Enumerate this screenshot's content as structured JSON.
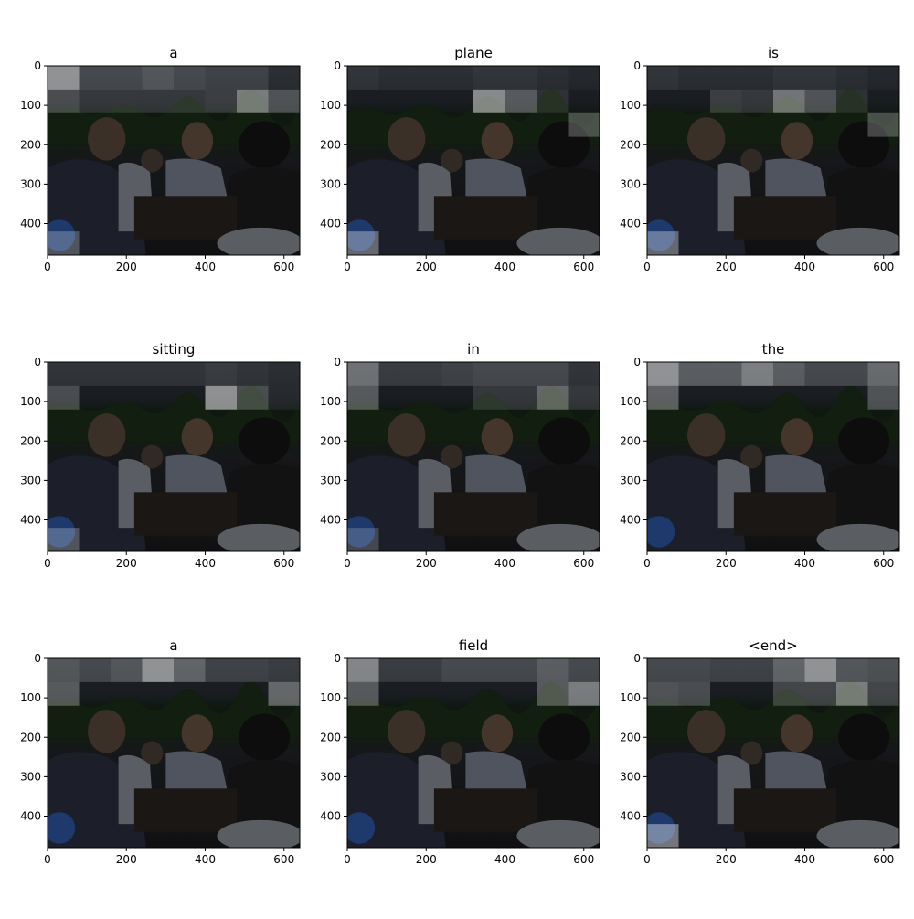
{
  "chart_data": {
    "type": "heatmap",
    "layout": "grid-3x3",
    "xlim": [
      0,
      640
    ],
    "ylim": [
      480,
      0
    ],
    "x_ticks": [
      0,
      200,
      400,
      600
    ],
    "y_ticks": [
      0,
      100,
      200,
      300,
      400
    ],
    "grid": false,
    "attention_grid": {
      "cols": 8,
      "rows": 8
    },
    "panels": [
      {
        "title": "a",
        "cells": [
          [
            0,
            0,
            0.85
          ],
          [
            1,
            0,
            0.3
          ],
          [
            2,
            0,
            0.3
          ],
          [
            3,
            0,
            0.4
          ],
          [
            4,
            0,
            0.3
          ],
          [
            5,
            0,
            0.25
          ],
          [
            6,
            0,
            0.25
          ],
          [
            7,
            0,
            0.1
          ],
          [
            0,
            1,
            0.35
          ],
          [
            1,
            1,
            0.2
          ],
          [
            2,
            1,
            0.2
          ],
          [
            3,
            1,
            0.2
          ],
          [
            4,
            1,
            0.2
          ],
          [
            5,
            1,
            0.25
          ],
          [
            6,
            1,
            0.7
          ],
          [
            7,
            1,
            0.4
          ],
          [
            0,
            7,
            0.4
          ]
        ]
      },
      {
        "title": "plane",
        "cells": [
          [
            0,
            0,
            0.15
          ],
          [
            1,
            0,
            0.1
          ],
          [
            2,
            0,
            0.1
          ],
          [
            3,
            0,
            0.1
          ],
          [
            4,
            0,
            0.15
          ],
          [
            5,
            0,
            0.15
          ],
          [
            6,
            0,
            0.1
          ],
          [
            7,
            0,
            0.05
          ],
          [
            4,
            1,
            0.8
          ],
          [
            5,
            1,
            0.45
          ],
          [
            6,
            1,
            0.15
          ],
          [
            7,
            2,
            0.4
          ],
          [
            0,
            7,
            0.55
          ]
        ]
      },
      {
        "title": "is",
        "cells": [
          [
            0,
            0,
            0.15
          ],
          [
            1,
            0,
            0.1
          ],
          [
            2,
            0,
            0.1
          ],
          [
            3,
            0,
            0.1
          ],
          [
            4,
            0,
            0.15
          ],
          [
            5,
            0,
            0.15
          ],
          [
            6,
            0,
            0.1
          ],
          [
            7,
            0,
            0.05
          ],
          [
            2,
            1,
            0.25
          ],
          [
            3,
            1,
            0.2
          ],
          [
            4,
            1,
            0.65
          ],
          [
            5,
            1,
            0.4
          ],
          [
            6,
            1,
            0.15
          ],
          [
            7,
            2,
            0.4
          ],
          [
            0,
            7,
            0.55
          ]
        ]
      },
      {
        "title": "sitting",
        "cells": [
          [
            0,
            0,
            0.15
          ],
          [
            1,
            0,
            0.15
          ],
          [
            2,
            0,
            0.15
          ],
          [
            3,
            0,
            0.15
          ],
          [
            4,
            0,
            0.15
          ],
          [
            5,
            0,
            0.2
          ],
          [
            6,
            0,
            0.15
          ],
          [
            7,
            0,
            0.1
          ],
          [
            0,
            1,
            0.35
          ],
          [
            5,
            1,
            0.85
          ],
          [
            6,
            1,
            0.35
          ],
          [
            7,
            1,
            0.1
          ],
          [
            0,
            7,
            0.4
          ]
        ]
      },
      {
        "title": "in",
        "cells": [
          [
            0,
            0,
            0.6
          ],
          [
            1,
            0,
            0.2
          ],
          [
            2,
            0,
            0.2
          ],
          [
            3,
            0,
            0.25
          ],
          [
            4,
            0,
            0.3
          ],
          [
            5,
            0,
            0.3
          ],
          [
            6,
            0,
            0.3
          ],
          [
            7,
            0,
            0.15
          ],
          [
            0,
            1,
            0.45
          ],
          [
            4,
            1,
            0.2
          ],
          [
            5,
            1,
            0.2
          ],
          [
            6,
            1,
            0.55
          ],
          [
            7,
            1,
            0.2
          ],
          [
            0,
            7,
            0.3
          ]
        ]
      },
      {
        "title": "the",
        "cells": [
          [
            0,
            0,
            0.85
          ],
          [
            1,
            0,
            0.45
          ],
          [
            2,
            0,
            0.45
          ],
          [
            3,
            0,
            0.7
          ],
          [
            4,
            0,
            0.45
          ],
          [
            5,
            0,
            0.3
          ],
          [
            6,
            0,
            0.3
          ],
          [
            7,
            0,
            0.55
          ],
          [
            0,
            1,
            0.5
          ],
          [
            7,
            1,
            0.4
          ]
        ]
      },
      {
        "title": "a",
        "cells": [
          [
            0,
            0,
            0.4
          ],
          [
            1,
            0,
            0.3
          ],
          [
            2,
            0,
            0.4
          ],
          [
            3,
            0,
            0.85
          ],
          [
            4,
            0,
            0.5
          ],
          [
            5,
            0,
            0.25
          ],
          [
            6,
            0,
            0.25
          ],
          [
            7,
            0,
            0.2
          ],
          [
            0,
            1,
            0.45
          ],
          [
            7,
            1,
            0.55
          ]
        ]
      },
      {
        "title": "field",
        "cells": [
          [
            0,
            0,
            0.75
          ],
          [
            1,
            0,
            0.2
          ],
          [
            2,
            0,
            0.2
          ],
          [
            3,
            0,
            0.3
          ],
          [
            4,
            0,
            0.3
          ],
          [
            5,
            0,
            0.3
          ],
          [
            6,
            0,
            0.45
          ],
          [
            7,
            0,
            0.3
          ],
          [
            0,
            1,
            0.45
          ],
          [
            6,
            1,
            0.45
          ],
          [
            7,
            1,
            0.7
          ]
        ]
      },
      {
        "title": "<end>",
        "cells": [
          [
            0,
            0,
            0.3
          ],
          [
            1,
            0,
            0.3
          ],
          [
            2,
            0,
            0.25
          ],
          [
            3,
            0,
            0.25
          ],
          [
            4,
            0,
            0.5
          ],
          [
            5,
            0,
            0.85
          ],
          [
            6,
            0,
            0.4
          ],
          [
            7,
            0,
            0.35
          ],
          [
            0,
            1,
            0.4
          ],
          [
            1,
            1,
            0.35
          ],
          [
            4,
            1,
            0.3
          ],
          [
            5,
            1,
            0.3
          ],
          [
            6,
            1,
            0.7
          ],
          [
            7,
            1,
            0.3
          ],
          [
            0,
            7,
            0.65
          ]
        ]
      }
    ]
  }
}
